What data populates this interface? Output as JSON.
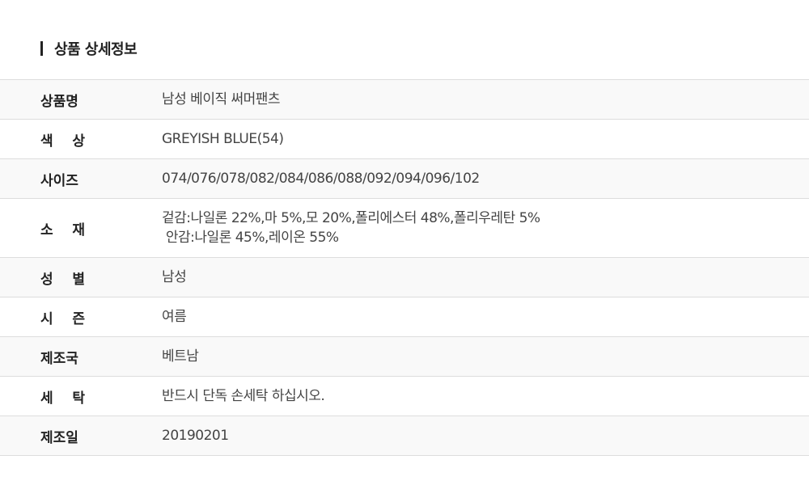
{
  "section": {
    "title": "상품 상세정보"
  },
  "rows": [
    {
      "label": "상품명",
      "lines": [
        "남성 베이직 써머팬츠"
      ]
    },
    {
      "label": "색    상",
      "lines": [
        "GREYISH BLUE(54)"
      ]
    },
    {
      "label": "사이즈",
      "lines": [
        "074/076/078/082/084/086/088/092/094/096/102"
      ]
    },
    {
      "label": "소    재",
      "lines": [
        "겉감:나일론 22%,마 5%,모 20%,폴리에스터 48%,폴리우레탄 5%",
        " 안감:나일론 45%,레이온 55%"
      ]
    },
    {
      "label": "성    별",
      "lines": [
        "남성"
      ]
    },
    {
      "label": "시    즌",
      "lines": [
        "여름"
      ]
    },
    {
      "label": "제조국",
      "lines": [
        "베트남"
      ]
    },
    {
      "label": "세    탁",
      "lines": [
        "반드시 단독 손세탁 하십시오."
      ]
    },
    {
      "label": "제조일",
      "lines": [
        "20190201"
      ]
    }
  ]
}
